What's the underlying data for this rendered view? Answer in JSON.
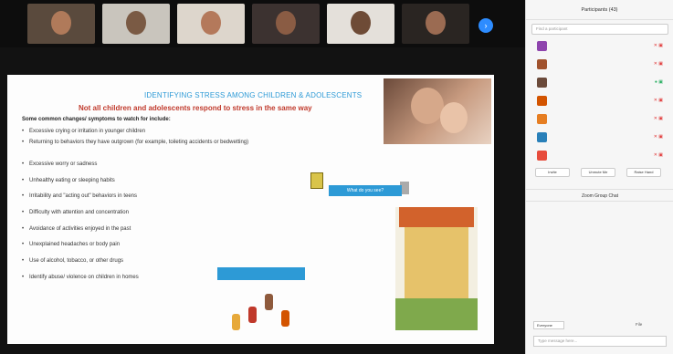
{
  "gallery": {
    "tiles": [
      {
        "name": "",
        "bg": "#5a4a3d",
        "skin": "#b07a5a"
      },
      {
        "name": "",
        "bg": "#c9c5bd",
        "skin": "#7a5a44"
      },
      {
        "name": "",
        "bg": "#ddd6cc",
        "skin": "#b4795b"
      },
      {
        "name": "",
        "bg": "#3c3230",
        "skin": "#8a5c44"
      },
      {
        "name": "",
        "bg": "#e4e0da",
        "skin": "#6e4b36"
      },
      {
        "name": "",
        "bg": "#2a2522",
        "skin": "#9b6b52"
      }
    ],
    "next_icon": "chevron-right-icon",
    "next_glyph": "›"
  },
  "slide": {
    "title": "IDENTIFYING STRESS AMONG CHILDREN & ADOLESCENTS",
    "subtitle": "Not all children and adolescents respond to stress in the same way",
    "intro": "Some common changes/ symptoms to watch for include:",
    "bullets": [
      "Excessive crying or irritation in younger children",
      "Returning to behaviors they have outgrown (for example, toileting accidents or bedwetting)",
      "Excessive worry or sadness",
      "Unhealthy eating or sleeping habits",
      "Irritability and \"acting out\" behaviors in teens",
      "Difficulty with attention and concentration",
      "Avoidance of activities enjoyed in the past",
      "Unexplained headaches or body pain",
      "Use of alcohol, tobacco, or other drugs",
      "Identify abuse/ violence on children in homes"
    ],
    "reveal_label": "What do you see?",
    "blue_box_label": "",
    "notes": [
      "",
      "",
      "",
      ""
    ]
  },
  "panel": {
    "participants_title": "Participants (43)",
    "search_placeholder": "Find a participant",
    "participants": [
      {
        "name": "",
        "color": "#8e44ad",
        "status": "✕ ▣"
      },
      {
        "name": "",
        "color": "#a0522d",
        "status": "✕ ▣"
      },
      {
        "name": "",
        "color": "#6b4a3a",
        "status": "● ▣"
      },
      {
        "name": "",
        "color": "#d35400",
        "status": "✕ ▣"
      },
      {
        "name": "",
        "color": "#e67e22",
        "status": "✕ ▣"
      },
      {
        "name": "",
        "color": "#2980b9",
        "status": "✕ ▣"
      },
      {
        "name": "",
        "color": "#e74c3c",
        "status": "✕ ▣"
      }
    ],
    "buttons": [
      "Invite",
      "Unmute Me",
      "Raise Hand"
    ],
    "chat_title": "Zoom Group Chat",
    "messages": [
      {
        "from": "",
        "text": ""
      },
      {
        "from": "",
        "text": ""
      },
      {
        "from": "",
        "text": ""
      },
      {
        "from": "",
        "text": ""
      }
    ],
    "chat_to_label": "Everyone",
    "file_label": "File",
    "chat_placeholder": "Type message here..."
  }
}
